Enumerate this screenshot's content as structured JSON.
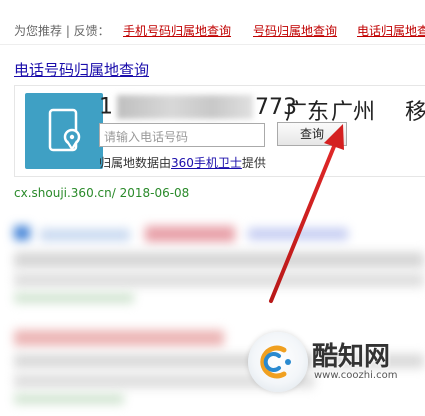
{
  "recommend": {
    "label": "为您推荐 | 反馈：",
    "links": [
      "手机号码归属地查询",
      "号码归属地查询",
      "电话归属地查询"
    ]
  },
  "result": {
    "title": "电话号码归属地查询",
    "number_prefix": "1",
    "number_suffix": "773",
    "province": "广东",
    "city": "广州",
    "carrier": "移",
    "input_placeholder": "请输入电话号码",
    "search_label": "查询",
    "provider_prefix": "归属地数据由",
    "provider_link": "360手机卫士",
    "provider_suffix": "提供",
    "url": "cx.shouji.360.cn/ 2018-06-08"
  },
  "watermark": {
    "brand": "酷知网",
    "domain": "www.coozhi.com"
  },
  "colors": {
    "link_red": "#c00000",
    "link_blue": "#1a0dab",
    "url_green": "#2a8a2a",
    "icon_bg": "#3fa0c4",
    "arrow_red": "#d42020"
  }
}
